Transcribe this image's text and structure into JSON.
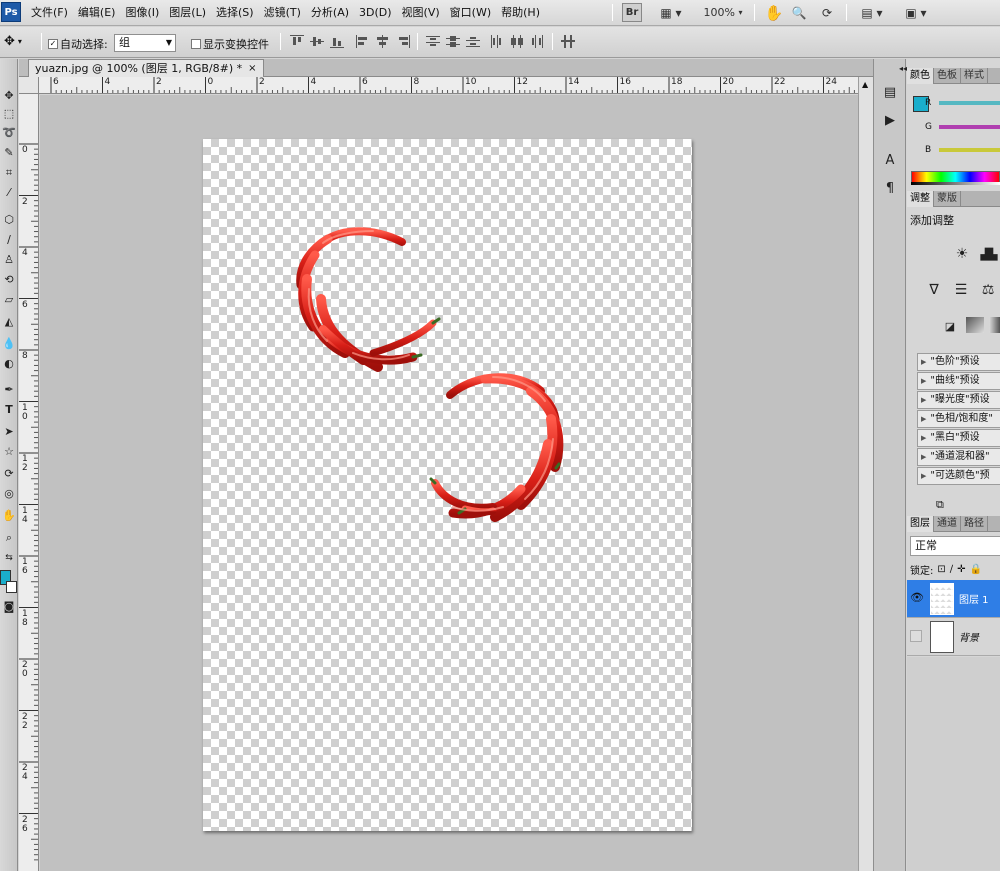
{
  "app": {
    "logo_text": "Ps",
    "menus": [
      "文件(F)",
      "编辑(E)",
      "图像(I)",
      "图层(L)",
      "选择(S)",
      "滤镜(T)",
      "分析(A)",
      "3D(D)",
      "视图(V)",
      "窗口(W)",
      "帮助(H)"
    ],
    "bridge_label": "Br",
    "zoom_label": "100%"
  },
  "options": {
    "auto_select_label": "自动选择:",
    "auto_select_checked_mark": "✓",
    "auto_select_value": "组",
    "show_transform_label": "显示变换控件"
  },
  "document": {
    "tab_title": "yuazn.jpg @ 100% (图层 1, RGB/8#) *",
    "close_glyph": "×",
    "ruler_top_labels": [
      "6",
      "4",
      "2",
      "0",
      "2",
      "4",
      "6",
      "8",
      "10",
      "12",
      "14",
      "16",
      "18",
      "20",
      "22",
      "24"
    ],
    "ruler_left_labels": [
      "0",
      "2",
      "4",
      "6",
      "8",
      "10",
      "12",
      "14",
      "16",
      "18",
      "20",
      "22",
      "24",
      "26"
    ]
  },
  "color_panel": {
    "tabs": [
      "颜色",
      "色板",
      "样式"
    ],
    "channel_labels": [
      "R",
      "G",
      "B"
    ],
    "foreground_color": "#1aaecc",
    "r_color": "#55b8c2",
    "g_color": "#b03fb0",
    "b_color": "#c9c93a"
  },
  "adjustments_panel": {
    "tabs": [
      "调整",
      "蒙版"
    ],
    "title": "添加调整",
    "presets": [
      "\"色阶\"预设",
      "\"曲线\"预设",
      "\"曝光度\"预设",
      "\"色相/饱和度\"",
      "\"黑白\"预设",
      "\"通道混和器\"",
      "\"可选颜色\"预"
    ]
  },
  "layers_panel": {
    "tabs": [
      "图层",
      "通道",
      "路径"
    ],
    "blend_mode": "正常",
    "lock_label": "锁定:",
    "layers": [
      {
        "name": "图层 1",
        "visible": true,
        "selected": true
      },
      {
        "name": "背景",
        "visible": false,
        "selected": false
      }
    ]
  }
}
